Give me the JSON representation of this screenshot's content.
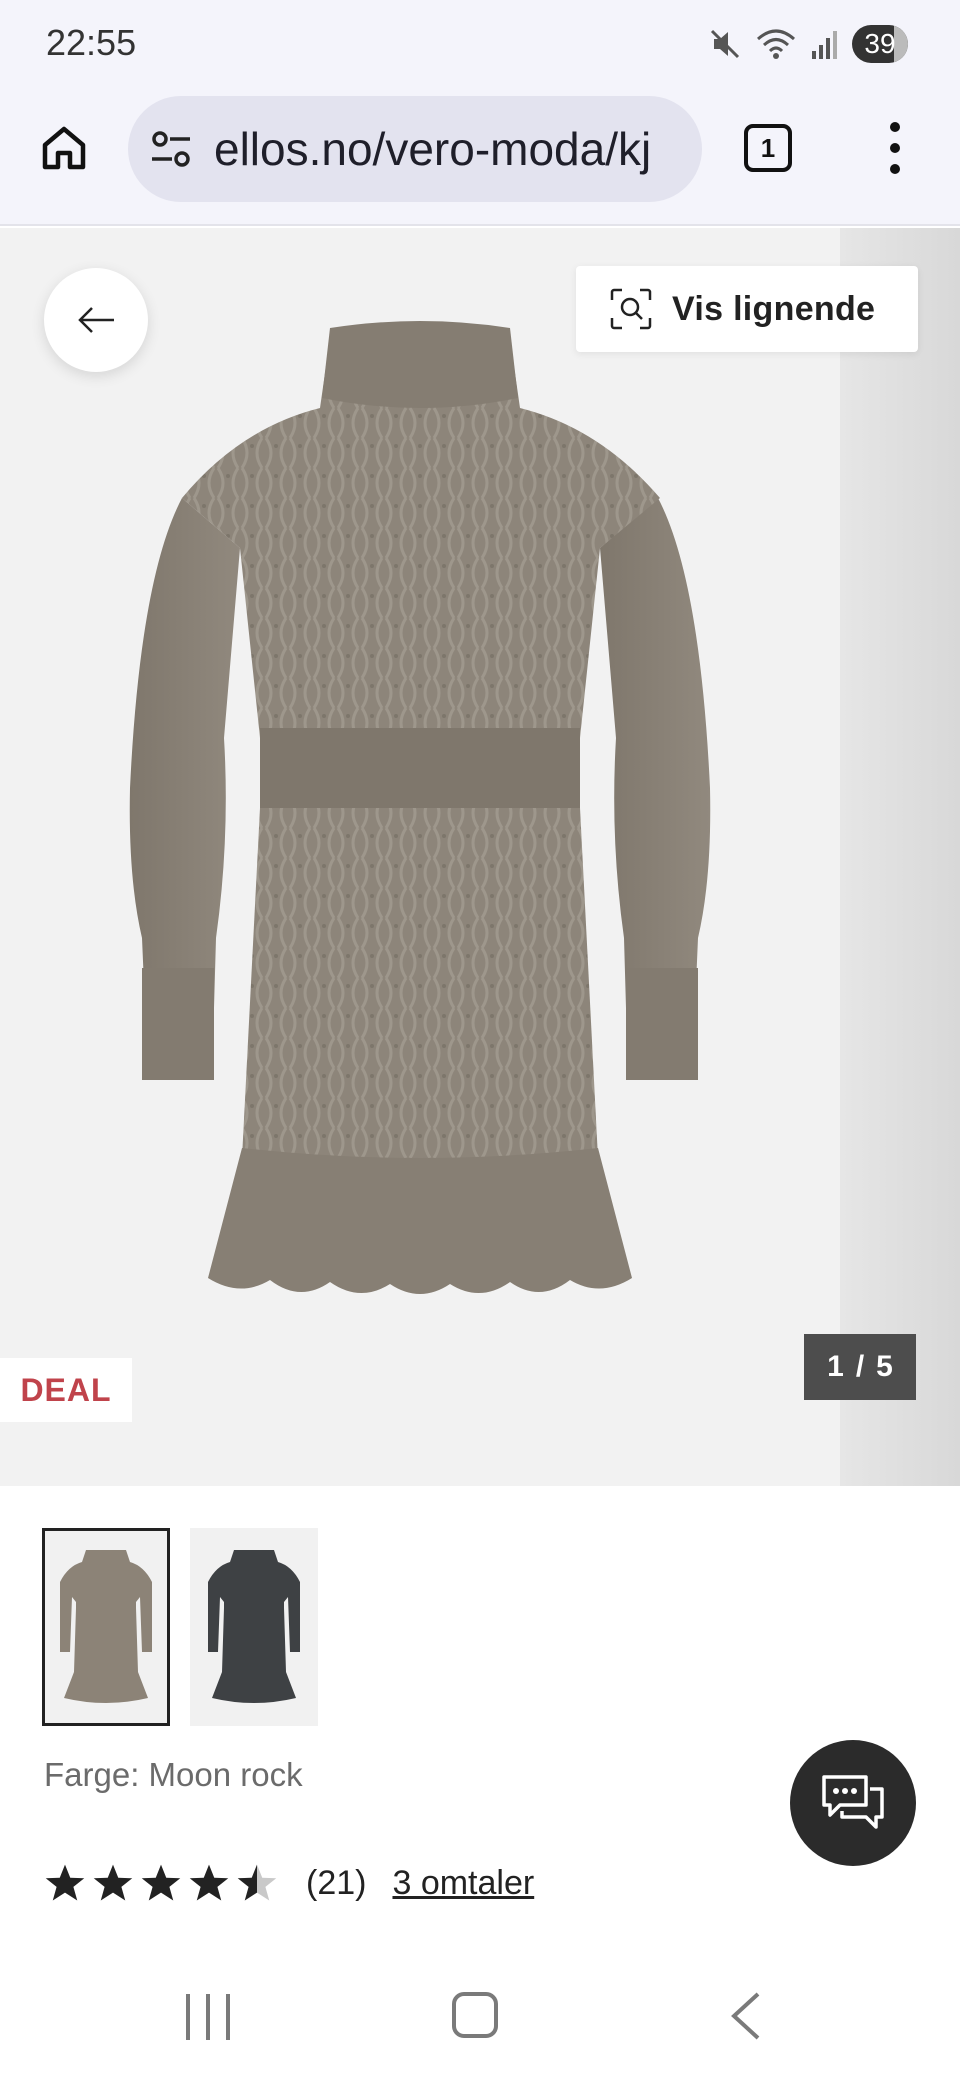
{
  "status_bar": {
    "time": "22:55",
    "battery": "39"
  },
  "browser": {
    "url": "ellos.no/vero-moda/kj",
    "tab_count": "1"
  },
  "product": {
    "similar_label": "Vis lignende",
    "badge": "DEAL",
    "image_counter": {
      "current": "1",
      "separator": "/",
      "total": "5"
    },
    "color_line": "Farge: Moon rock",
    "thumbnails": [
      {
        "name": "moon-rock",
        "color": "#8c8377",
        "selected": true
      },
      {
        "name": "dark-grey",
        "color": "#3e4144",
        "selected": false
      }
    ],
    "rating": {
      "value": 4.5,
      "max": 5,
      "count_text": "(21)",
      "reviews_text": "3 omtaler"
    }
  },
  "colors": {
    "deal_red": "#c0434b",
    "dress_main": "#8f877c",
    "dark_btn": "#2b2b2b"
  },
  "icons": [
    "home-icon",
    "site-settings-icon",
    "tabs-icon",
    "more-vert-icon",
    "arrow-back-icon",
    "visual-search-icon",
    "chat-icon",
    "star-icon"
  ]
}
